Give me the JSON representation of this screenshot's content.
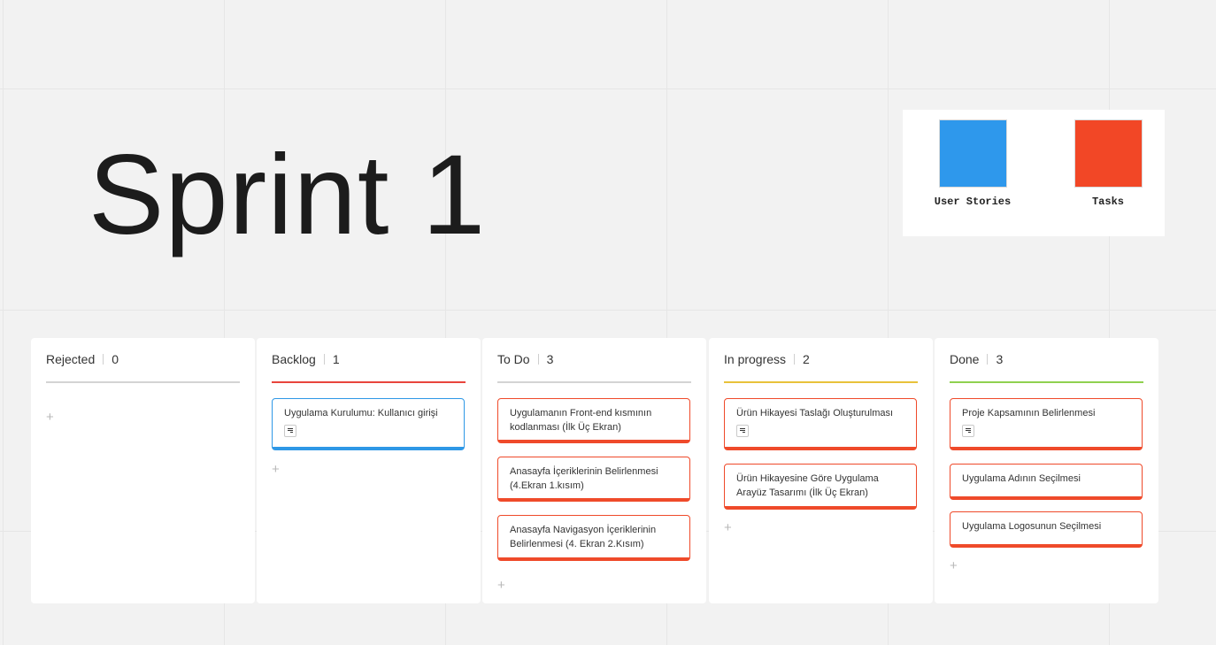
{
  "board_title": "Sprint 1",
  "legend": {
    "items": [
      {
        "label": "User Stories",
        "color": "#2e98ec"
      },
      {
        "label": "Tasks",
        "color": "#f24726"
      }
    ]
  },
  "columns": [
    {
      "title": "Rejected",
      "count": "0",
      "accent_color": "#d4d4d4",
      "add_label": "+",
      "cards": []
    },
    {
      "title": "Backlog",
      "count": "1",
      "accent_color": "#e8453c",
      "add_label": "+",
      "cards": [
        {
          "text": "Uygulama Kurulumu: Kullanıcı girişi",
          "type": "user-story",
          "has_note": true
        }
      ]
    },
    {
      "title": "To Do",
      "count": "3",
      "accent_color": "#d4d4d4",
      "add_label": "+",
      "cards": [
        {
          "text": "Uygulamanın Front-end kısmının kodlanması  (İlk Üç Ekran)",
          "type": "task",
          "has_note": false
        },
        {
          "text": "Anasayfa İçeriklerinin Belirlenmesi (4.Ekran 1.kısım)",
          "type": "task",
          "has_note": false
        },
        {
          "text": "Anasayfa Navigasyon İçeriklerinin Belirlenmesi (4. Ekran 2.Kısım)",
          "type": "task",
          "has_note": false
        }
      ]
    },
    {
      "title": "In progress",
      "count": "2",
      "accent_color": "#e8c23a",
      "add_label": "+",
      "cards": [
        {
          "text": "Ürün Hikayesi Taslağı Oluşturulması",
          "type": "task",
          "has_note": true
        },
        {
          "text": "Ürün Hikayesine Göre Uygulama Arayüz Tasarımı (İlk Üç Ekran)",
          "type": "task",
          "has_note": false
        }
      ]
    },
    {
      "title": "Done",
      "count": "3",
      "accent_color": "#8fd14f",
      "add_label": "+",
      "cards": [
        {
          "text": "Proje Kapsamının Belirlenmesi",
          "type": "task",
          "has_note": true
        },
        {
          "text": "Uygulama Adının Seçilmesi",
          "type": "task",
          "has_note": false
        },
        {
          "text": "Uygulama Logosunun Seçilmesi",
          "type": "task",
          "has_note": false
        }
      ]
    }
  ]
}
